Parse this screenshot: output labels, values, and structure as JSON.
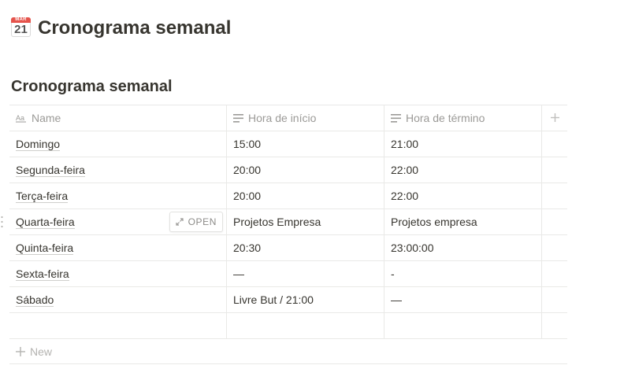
{
  "page": {
    "title": "Cronograma semanal",
    "icon": {
      "name": "calendar-icon",
      "month": "MAR",
      "day": "21"
    }
  },
  "database": {
    "title": "Cronograma semanal",
    "columns": [
      {
        "label": "Name",
        "icon": "text-type-icon"
      },
      {
        "label": "Hora de início",
        "icon": "text-lines-icon"
      },
      {
        "label": "Hora de término",
        "icon": "text-lines-icon"
      }
    ],
    "add_column_icon": "plus-icon",
    "open_label": "OPEN",
    "rows": [
      {
        "name": "Domingo",
        "start": "15:00",
        "end": "21:00"
      },
      {
        "name": "Segunda-feira",
        "start": "20:00",
        "end": "22:00"
      },
      {
        "name": "Terça-feira",
        "start": "20:00",
        "end": "22:00"
      },
      {
        "name": "Quarta-feira",
        "start": "Projetos Empresa",
        "end": "Projetos empresa"
      },
      {
        "name": "Quinta-feira",
        "start": "20:30",
        "end": "23:00:00"
      },
      {
        "name": "Sexta-feira",
        "start": "—",
        "end": "-"
      },
      {
        "name": "Sábado",
        "start": "Livre But /  21:00",
        "end": "—"
      },
      {
        "name": "",
        "start": "",
        "end": ""
      }
    ],
    "new_label": "New"
  },
  "colors": {
    "text": "#37352f",
    "muted": "#9b9a97",
    "border": "#e9e9e7",
    "icon_red": "#e5534b"
  }
}
